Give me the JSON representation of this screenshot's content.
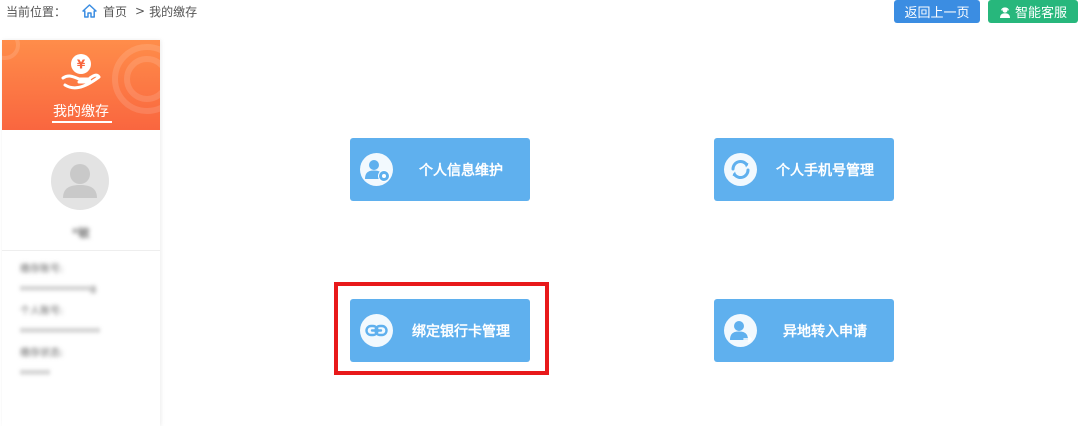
{
  "breadcrumb": {
    "prefix": "当前位置：",
    "home": "首页",
    "separator": ">",
    "current": "我的缴存"
  },
  "top_buttons": {
    "back": "返回上一页",
    "service": "智能客服"
  },
  "sidebar": {
    "title": "我的缴存",
    "username": "*敏",
    "info_lines": [
      "缴存账号:",
      "**************8",
      "个人账号:",
      "****************",
      "缴存状态:",
      "******"
    ]
  },
  "tiles": [
    {
      "label": "个人信息维护",
      "icon": "user-settings-icon"
    },
    {
      "label": "个人手机号管理",
      "icon": "refresh-icon"
    },
    {
      "label": "绑定银行卡管理",
      "icon": "link-icon"
    },
    {
      "label": "异地转入申请",
      "icon": "user-transfer-icon"
    }
  ],
  "colors": {
    "tile": "#5fb0ee",
    "sidebar_header": "#f9663f",
    "back_button": "#3b8de2",
    "service_button": "#27b77c",
    "highlight": "#e8191a"
  }
}
